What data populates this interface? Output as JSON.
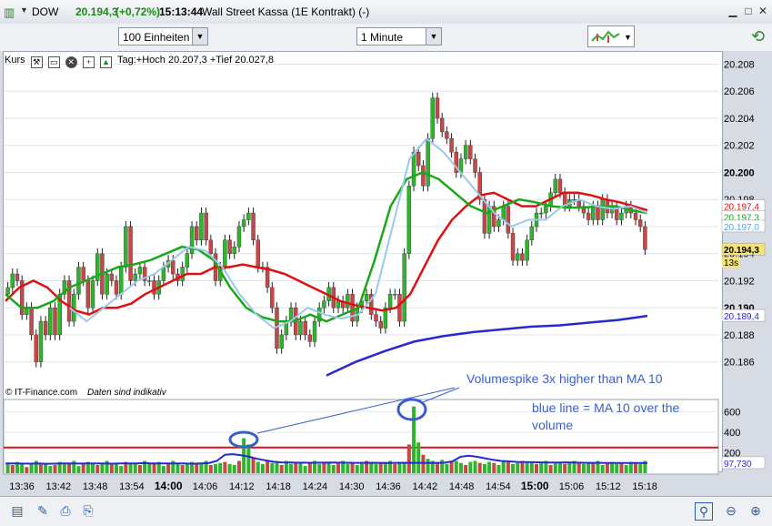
{
  "window": {
    "symbol": "DOW",
    "price": "20.194,3",
    "change": "(+0,72%)",
    "time": "15:13:44",
    "description": "Wall Street Kassa (1E Kontrakt) (-)"
  },
  "toolbar": {
    "units_select": "100 Einheiten",
    "interval_select": "1 Minute"
  },
  "panel": {
    "label": "Kurs",
    "day_high_low": "Tag:+Hoch 20.207,3 +Tief 20.027,8"
  },
  "watermark": {
    "source": "© IT-Finance.com",
    "note": "Daten sind indikativ"
  },
  "annotations": {
    "volume_spike": "Volumespike 3x higher than MA 10",
    "blue_line_1": "blue line = MA 10 over the",
    "blue_line_2": "volume"
  },
  "price_labels": {
    "ma_red": "20.197,4",
    "ma_green": "20.197,3",
    "ma_light": "20.197,0",
    "last": "20.194,3",
    "countdown": "13s",
    "ma_blue": "20.189,4",
    "volume_ma": "97,730"
  },
  "colors": {
    "up": "#2db52d",
    "down": "#c84646",
    "ma_red": "#e01010",
    "ma_green": "#18a818",
    "ma_light": "#9cc8ec",
    "ma_blue": "#2828d0",
    "annotation": "#3a5fcd"
  },
  "chart_data": [
    {
      "type": "candlestick",
      "title": "Kurs",
      "x_tick_labels": [
        "13:36",
        "13:42",
        "13:48",
        "13:54",
        "14:00",
        "14:06",
        "14:12",
        "14:18",
        "14:24",
        "14:30",
        "14:36",
        "14:42",
        "14:48",
        "14:54",
        "15:00",
        "15:06",
        "15:12",
        "15:18"
      ],
      "y_tick_labels": [
        "20.186",
        "20.188",
        "20.190",
        "20.192",
        "20.194",
        "20.196",
        "20.198",
        "20.200",
        "20.202",
        "20.204",
        "20.206",
        "20.208"
      ],
      "ylim": [
        20.1845,
        20.2085
      ],
      "close": [
        20.1915,
        20.1925,
        20.192,
        20.1895,
        20.19,
        20.188,
        20.186,
        20.189,
        20.188,
        20.19,
        20.188,
        20.191,
        20.192,
        20.189,
        20.191,
        20.193,
        20.192,
        20.19,
        20.192,
        20.194,
        20.191,
        20.1925,
        20.192,
        20.191,
        20.193,
        20.196,
        20.192,
        20.1925,
        20.193,
        20.192,
        20.192,
        20.191,
        20.192,
        20.193,
        20.1935,
        20.1925,
        20.192,
        20.193,
        20.194,
        20.196,
        20.195,
        20.197,
        20.195,
        20.194,
        20.192,
        20.193,
        20.195,
        20.194,
        20.1945,
        20.196,
        20.1965,
        20.197,
        20.195,
        20.193,
        20.193,
        20.1915,
        20.19,
        20.187,
        20.188,
        20.189,
        20.19,
        20.188,
        20.189,
        20.188,
        20.1875,
        20.189,
        20.19,
        20.1905,
        20.1915,
        20.19,
        20.1905,
        20.19,
        20.191,
        20.189,
        20.19,
        20.1905,
        20.191,
        20.1895,
        20.189,
        20.1885,
        20.19,
        20.191,
        20.191,
        20.189,
        20.194,
        20.199,
        20.2015,
        20.2005,
        20.199,
        20.2025,
        20.2055,
        20.204,
        20.203,
        20.2025,
        20.2015,
        20.2,
        20.201,
        20.202,
        20.201,
        20.2,
        20.198,
        20.1955,
        20.1975,
        20.196,
        20.1965,
        20.1975,
        20.1955,
        20.1935,
        20.194,
        20.1935,
        20.195,
        20.196,
        20.197,
        20.197,
        20.1975,
        20.1985,
        20.1995,
        20.1985,
        20.1975,
        20.198,
        20.198,
        20.1975,
        20.197,
        20.1965,
        20.1975,
        20.1965,
        20.198,
        20.197,
        20.1975,
        20.1965,
        20.197,
        20.1975,
        20.197,
        20.1965,
        20.196,
        20.1943
      ],
      "series": [
        {
          "name": "MA red",
          "values": [
            20.1905,
            20.1915,
            20.192,
            20.1915,
            20.1905,
            20.1898,
            20.1895,
            20.19,
            20.19,
            20.1903,
            20.191,
            20.1915,
            20.192,
            20.1925,
            20.1925,
            20.193,
            20.193,
            20.1932,
            20.193,
            20.1928,
            20.1925,
            20.192,
            20.1915,
            20.191,
            20.1905,
            20.1902,
            20.19,
            20.1898,
            20.19,
            20.191,
            20.193,
            20.195,
            20.1965,
            20.1975,
            20.1983,
            20.1985,
            20.198,
            20.1975,
            20.1975,
            20.198,
            20.1985,
            20.1985,
            20.1983,
            20.198,
            20.1978,
            20.1975,
            20.1972
          ]
        },
        {
          "name": "MA green",
          "values": [
            20.191,
            20.19,
            20.19,
            20.1905,
            20.1915,
            20.192,
            20.1925,
            20.193,
            20.1932,
            20.1935,
            20.194,
            20.1945,
            20.1943,
            20.1935,
            20.1915,
            20.19,
            20.1893,
            20.189,
            20.189,
            20.1895,
            20.189,
            20.1895,
            20.19,
            20.1935,
            20.1975,
            20.1995,
            20.2,
            20.1995,
            20.1985,
            20.1975,
            20.197,
            20.1975,
            20.198,
            20.1978,
            20.1975,
            20.1974,
            20.1974,
            20.1975,
            20.1975,
            20.1972,
            20.197
          ]
        },
        {
          "name": "MA light",
          "values": [
            20.19,
            20.189,
            20.19,
            20.191,
            20.192,
            20.1925,
            20.1935,
            20.1945,
            20.1942,
            20.193,
            20.191,
            20.1895,
            20.1885,
            20.189,
            20.19,
            20.1895,
            20.1892,
            20.1895,
            20.191,
            20.196,
            20.201,
            20.2025,
            20.2015,
            20.2,
            20.1985,
            20.197,
            20.196,
            20.1965,
            20.1965,
            20.1975,
            20.198,
            20.1975,
            20.1973,
            20.1975,
            20.197
          ]
        },
        {
          "name": "MA blue",
          "values": [
            20.185,
            20.186,
            20.1868,
            20.1875,
            20.1879,
            20.1882,
            20.1884,
            20.1886,
            20.1887,
            20.1889,
            20.1891,
            20.1894
          ]
        }
      ]
    },
    {
      "type": "bar",
      "title": "Volume",
      "y_tick_labels": [
        "200",
        "400",
        "600"
      ],
      "ylim": [
        0,
        700
      ],
      "horizontal_line": 250,
      "values": [
        100,
        80,
        110,
        90,
        60,
        100,
        120,
        90,
        100,
        70,
        80,
        110,
        100,
        90,
        120,
        70,
        100,
        110,
        90,
        80,
        100,
        120,
        90,
        100,
        70,
        110,
        90,
        100,
        80,
        120,
        100,
        90,
        110,
        70,
        100,
        120,
        90,
        80,
        100,
        110,
        90,
        100,
        120,
        80,
        90,
        100,
        110,
        90,
        80,
        120,
        340,
        280,
        150,
        110,
        90,
        120,
        100,
        110,
        80,
        120,
        90,
        100,
        110,
        70,
        100,
        120,
        90,
        100,
        110,
        80,
        100,
        120,
        90,
        100,
        80,
        110,
        120,
        100,
        90,
        100,
        110,
        120,
        90,
        110,
        100,
        280,
        650,
        300,
        180,
        140,
        120,
        100,
        130,
        90,
        110,
        120,
        100,
        80,
        110,
        120,
        100,
        90,
        110,
        100,
        80,
        120,
        110,
        90,
        100,
        120,
        100,
        110,
        90,
        100,
        120,
        80,
        110,
        100,
        90,
        110,
        120,
        100,
        90,
        110,
        100,
        120,
        80,
        100,
        110,
        90,
        100,
        80,
        110,
        100,
        90,
        120
      ],
      "series": [
        {
          "name": "MA 10",
          "values": [
            96,
            96,
            94,
            93,
            95,
            92,
            93,
            96,
            95,
            94,
            95,
            96,
            96,
            93,
            95,
            96,
            95,
            98,
            95,
            96,
            95,
            96,
            95,
            92,
            95,
            98,
            120,
            180,
            185,
            175,
            160,
            140,
            125,
            112,
            105,
            104,
            103,
            102,
            102,
            103,
            104,
            103,
            102,
            101,
            101,
            102,
            101,
            100,
            101,
            102,
            101,
            101,
            100,
            101,
            102,
            115,
            160,
            170,
            160,
            145,
            130,
            120,
            115,
            110,
            108,
            107,
            105,
            104,
            104,
            105,
            104,
            102,
            101,
            101,
            100,
            99,
            100,
            100,
            99,
            98
          ]
        }
      ]
    }
  ]
}
